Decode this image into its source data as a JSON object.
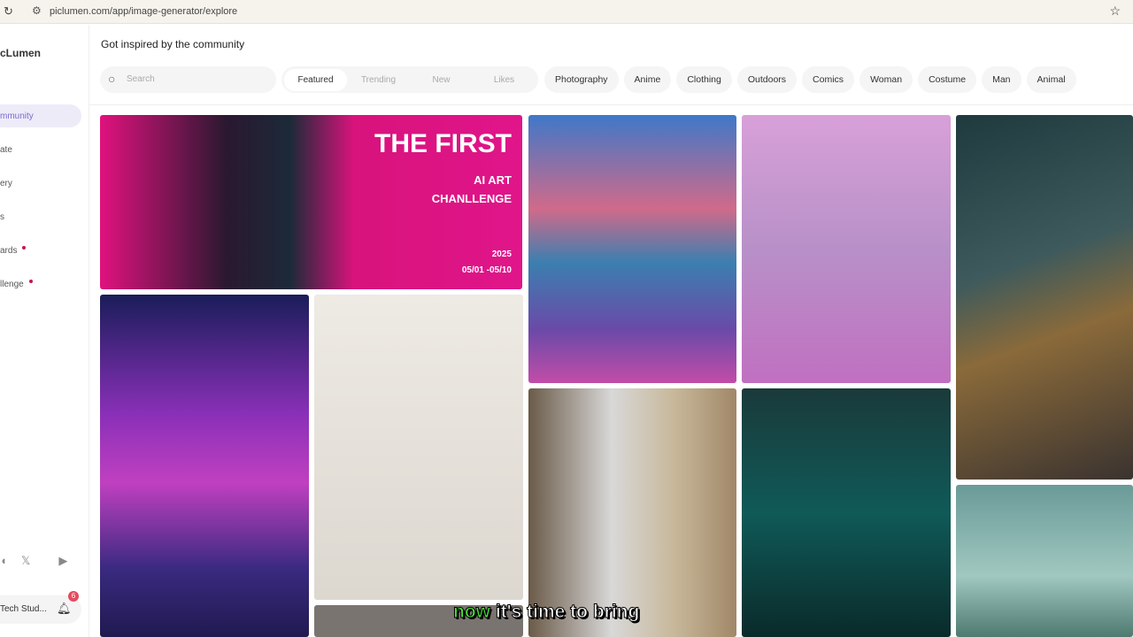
{
  "browser": {
    "url": "piclumen.com/app/image-generator/explore"
  },
  "sidebar": {
    "logo": "cLumen",
    "items": [
      {
        "label": "mmunity"
      },
      {
        "label": "ate"
      },
      {
        "label": "ery"
      },
      {
        "label": "s"
      },
      {
        "label": "ards"
      },
      {
        "label": "llenge"
      }
    ],
    "user": "Tech Stud...",
    "notif_count": "6"
  },
  "header": {
    "title": "Got inspired by the community",
    "search_placeholder": "Search"
  },
  "sort_tabs": [
    "Featured",
    "Trending",
    "New",
    "Likes"
  ],
  "categories": [
    "Photography",
    "Anime",
    "Clothing",
    "Outdoors",
    "Comics",
    "Woman",
    "Costume",
    "Man",
    "Animal"
  ],
  "banner": {
    "title": "THE FIRST",
    "sub1": "AI ART",
    "sub2": "CHANLLENGE",
    "year": "2025",
    "dates": "05/01 -05/10"
  },
  "caption": {
    "highlight": "now",
    "rest": " it's time to bring"
  }
}
